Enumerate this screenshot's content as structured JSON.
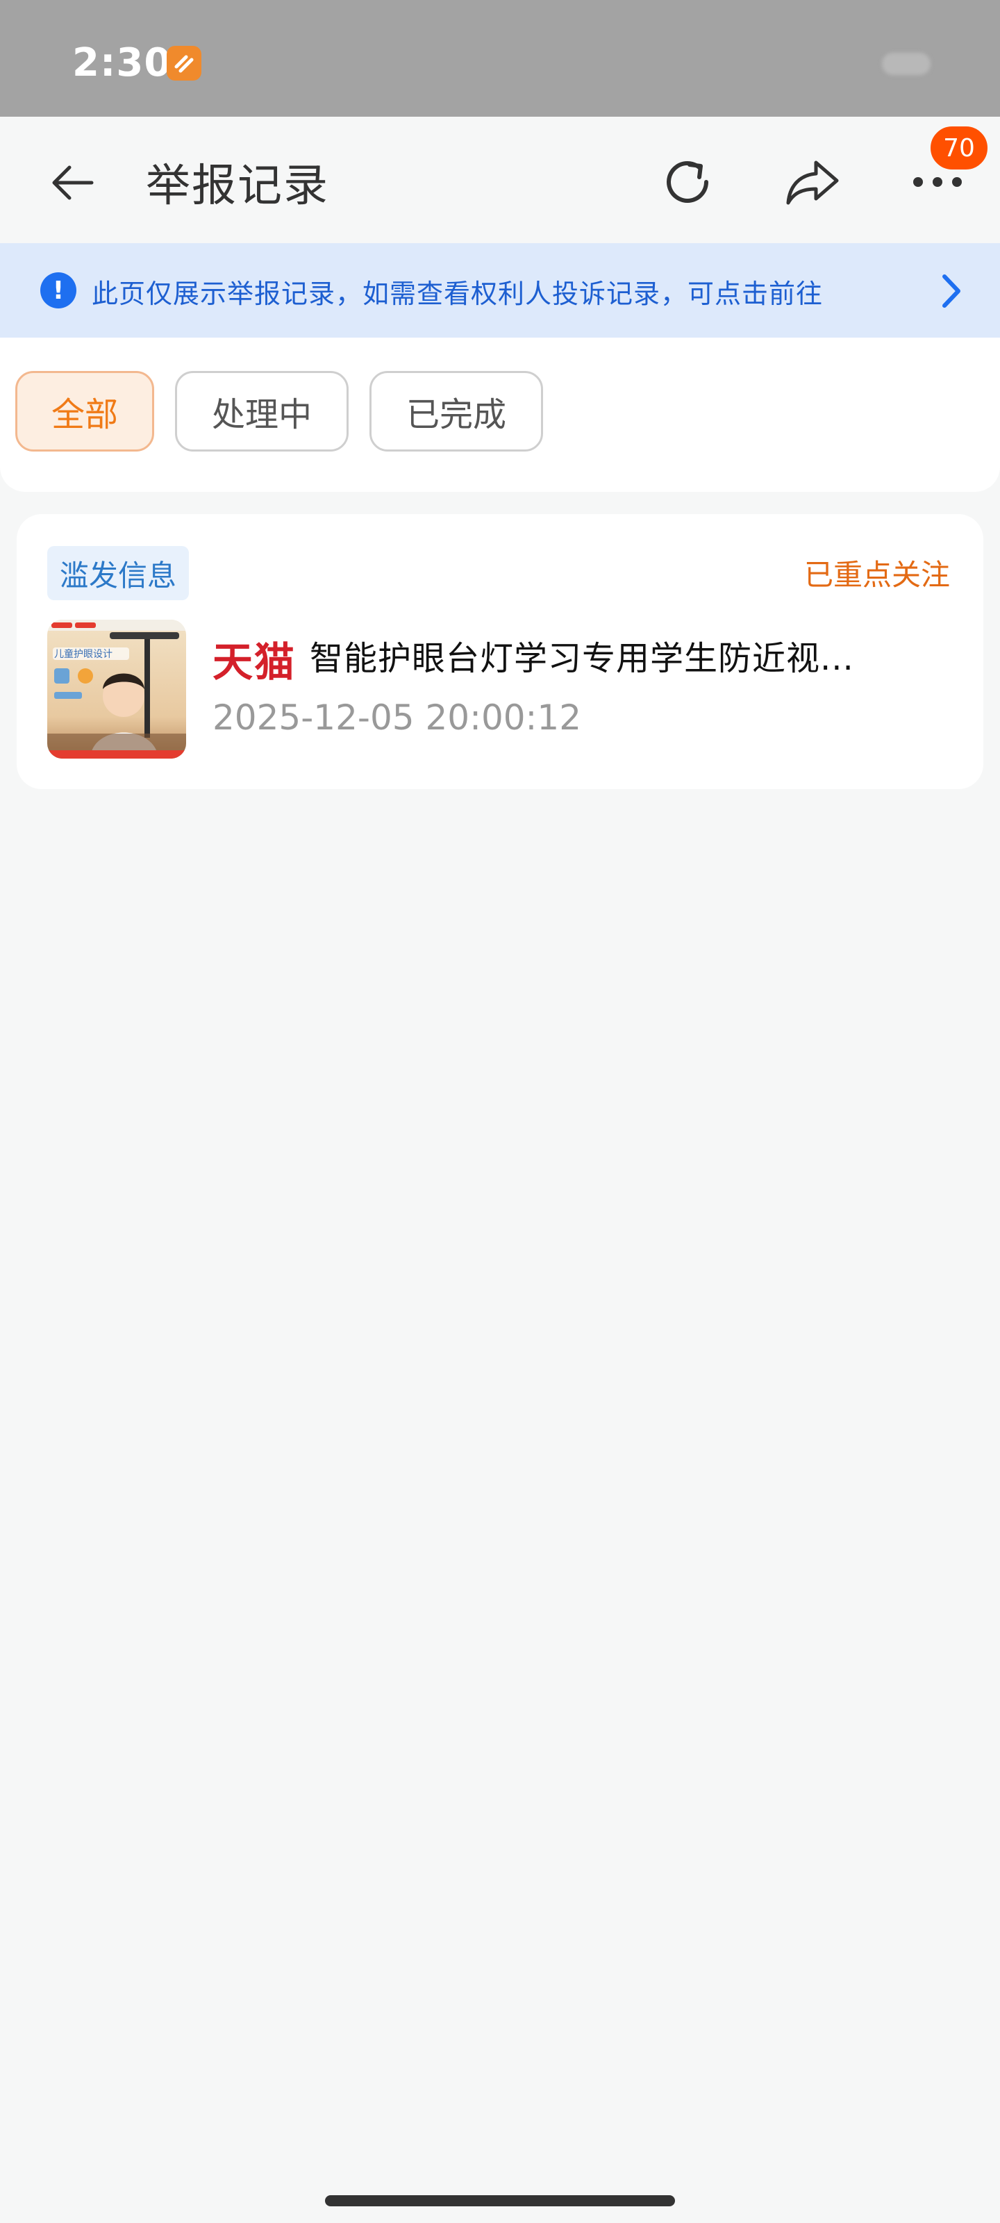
{
  "status_bar": {
    "time": "2:30"
  },
  "navbar": {
    "title": "举报记录",
    "more_badge": "70"
  },
  "notice": {
    "text": "此页仅展示举报记录，如需查看权利人投诉记录，可点击前往",
    "icon_glyph": "!"
  },
  "filters": [
    {
      "label": "全部",
      "active": true
    },
    {
      "label": "处理中",
      "active": false
    },
    {
      "label": "已完成",
      "active": false
    }
  ],
  "records": [
    {
      "type_tag": "滥发信息",
      "status": "已重点关注",
      "shop": "天猫",
      "title": "智能护眼台灯学习专用学生防近视...",
      "time": "2025-12-05 20:00:12",
      "thumb_caption": "儿童护眼设计"
    }
  ],
  "colors": {
    "accent_orange": "#f07a16",
    "badge_red": "#ff5000",
    "notice_blue": "#1d5fd1",
    "tmall_red": "#d4202a"
  }
}
